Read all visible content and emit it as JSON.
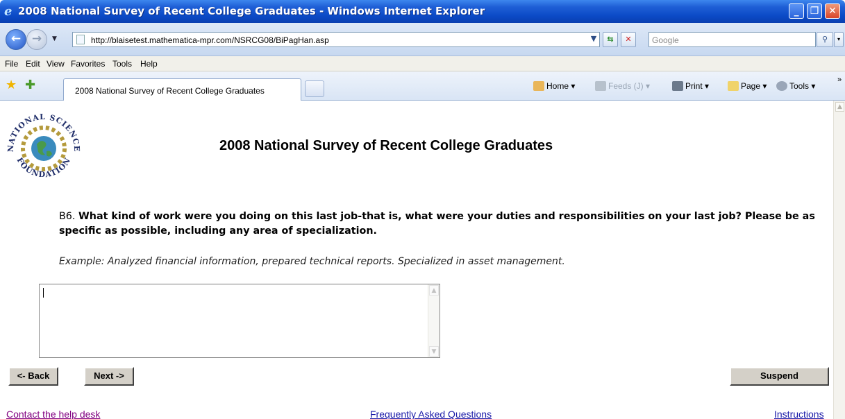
{
  "window": {
    "title": "2008 National Survey of Recent College Graduates - Windows Internet Explorer"
  },
  "address_bar": {
    "url": "http://blaisetest.mathematica-mpr.com/NSRCG08/BiPagHan.asp",
    "search_placeholder": "Google"
  },
  "menu": {
    "items": [
      "File",
      "Edit",
      "View",
      "Favorites",
      "Tools",
      "Help"
    ]
  },
  "tabs": {
    "active_label": "2008 National Survey of Recent College Graduates"
  },
  "command_bar": {
    "home": "Home",
    "feeds": "Feeds (J)",
    "print": "Print",
    "page": "Page",
    "tools": "Tools"
  },
  "page": {
    "logo_top_text": "NATIONAL SCIENCE",
    "logo_bottom_text": "FOUNDATION",
    "heading": "2008 National Survey of Recent College Graduates",
    "question_number": "B6.",
    "question_text": "What kind of work were you doing on this last job-that is, what were your duties and responsibilities on your last job? Please be as specific as possible, including any area of specialization.",
    "example": "Example: Analyzed financial information, prepared technical reports. Specialized in asset management.",
    "answer_value": "",
    "buttons": {
      "back": "<- Back",
      "next": "Next ->",
      "suspend": "Suspend"
    },
    "links": {
      "help_desk": "Contact the help desk",
      "faq": "Frequently Asked Questions",
      "instructions": "Instructions"
    }
  },
  "colors": {
    "titlebar": "#0b4ac6",
    "link": "#1a1aa8",
    "visited_link": "#800080",
    "button_face": "#d4d0c8"
  }
}
